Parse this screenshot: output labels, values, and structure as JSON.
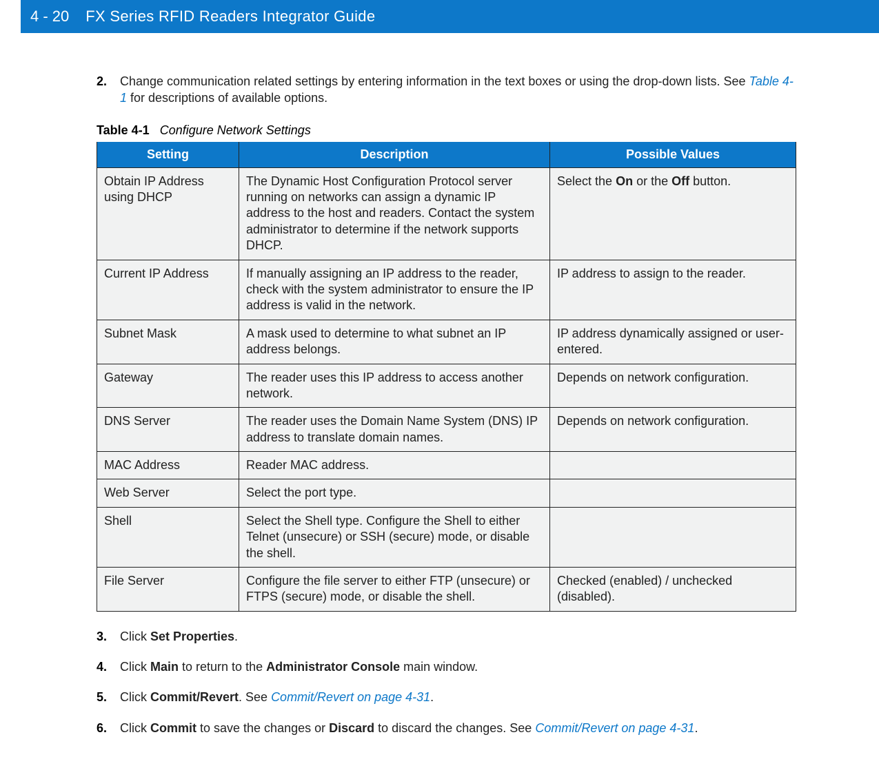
{
  "header": {
    "page_number": "4 - 20",
    "title": "FX Series RFID Readers Integrator Guide"
  },
  "step2": {
    "num": "2.",
    "text": "Change communication related settings by entering information in the text boxes or using the drop-down lists. See ",
    "link": "Table 4-1",
    "after": " for descriptions of available options."
  },
  "table_caption": {
    "label": "Table 4-1",
    "title": "Configure Network Settings"
  },
  "table": {
    "headers": {
      "setting": "Setting",
      "description": "Description",
      "values": "Possible Values"
    },
    "rows": [
      {
        "setting": "Obtain IP Address using DHCP",
        "description": "The Dynamic Host Configuration Protocol server running on networks can assign a dynamic IP address to the host and readers. Contact the system administrator to determine if the network supports DHCP.",
        "values_pre": "Select the ",
        "values_b1": "On",
        "values_mid": " or the ",
        "values_b2": "Off",
        "values_post": " button."
      },
      {
        "setting": "Current IP Address",
        "description": "If manually assigning an IP address to the reader, check with the system administrator to ensure the IP address is valid in the network.",
        "values": "IP address to assign to the reader."
      },
      {
        "setting": "Subnet Mask",
        "description": "A mask used to determine to what subnet an IP address belongs.",
        "values": "IP address dynamically assigned or user-entered."
      },
      {
        "setting": "Gateway",
        "description": "The reader uses this IP address to access another network.",
        "values": "Depends on network configuration."
      },
      {
        "setting": "DNS Server",
        "description": "The reader uses the Domain Name System (DNS) IP address to translate domain names.",
        "values": "Depends on network configuration."
      },
      {
        "setting": "MAC Address",
        "description": "Reader MAC address.",
        "values": ""
      },
      {
        "setting": "Web Server",
        "description": "Select the port type.",
        "values": ""
      },
      {
        "setting": "Shell",
        "description": "Select the Shell type. Configure the Shell to either Telnet (unsecure) or SSH (secure) mode, or disable the shell.",
        "values": ""
      },
      {
        "setting": "File Server",
        "description": "Configure the file server to either FTP (unsecure) or FTPS (secure) mode, or disable the shell.",
        "values": "Checked (enabled) / unchecked (disabled)."
      }
    ]
  },
  "step3": {
    "num": "3.",
    "pre": "Click ",
    "b1": "Set Properties",
    "post": "."
  },
  "step4": {
    "num": "4.",
    "pre": "Click ",
    "b1": "Main",
    "mid": " to return to the ",
    "b2": "Administrator Console",
    "post": " main window."
  },
  "step5": {
    "num": "5.",
    "pre": "Click ",
    "b1": "Commit/Revert",
    "mid": ". See ",
    "link": "Commit/Revert on page 4-31",
    "post": "."
  },
  "step6": {
    "num": "6.",
    "pre": "Click ",
    "b1": "Commit",
    "mid1": " to save the changes or ",
    "b2": "Discard",
    "mid2": " to discard the changes. See ",
    "link": "Commit/Revert on page 4-31",
    "post": "."
  }
}
